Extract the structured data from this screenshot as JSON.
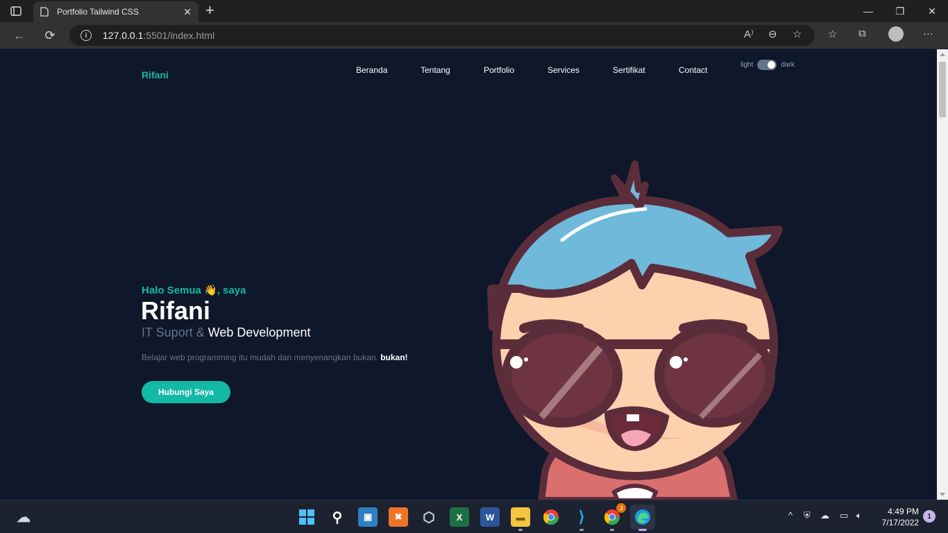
{
  "browser": {
    "tab_title": "Portfolio Tailwind CSS",
    "url_host": "127.0.0.1",
    "url_path": ":5501/index.html"
  },
  "navbar": {
    "brand": "Rifani",
    "menu": [
      "Beranda",
      "Tentang",
      "Portfolio",
      "Services",
      "Sertifikat",
      "Contact"
    ],
    "theme_light": "light",
    "theme_dark": "dark"
  },
  "hero": {
    "greeting": "Halo Semua 👋, saya",
    "name": "Rifani",
    "role_prefix": "IT Suport & ",
    "role_highlight": "Web Development",
    "description": "Belajar web programming itu mudah dan menyenangkan bukan. ",
    "description_bold": "bukan!",
    "cta_label": "Hubungi Saya"
  },
  "taskbar": {
    "time": "4:49 PM",
    "date": "7/17/2022",
    "notification_count": "1",
    "chrome_badge": "J"
  },
  "colors": {
    "accent": "#14b8a6",
    "background": "#0f172a",
    "muted": "#64748b"
  }
}
